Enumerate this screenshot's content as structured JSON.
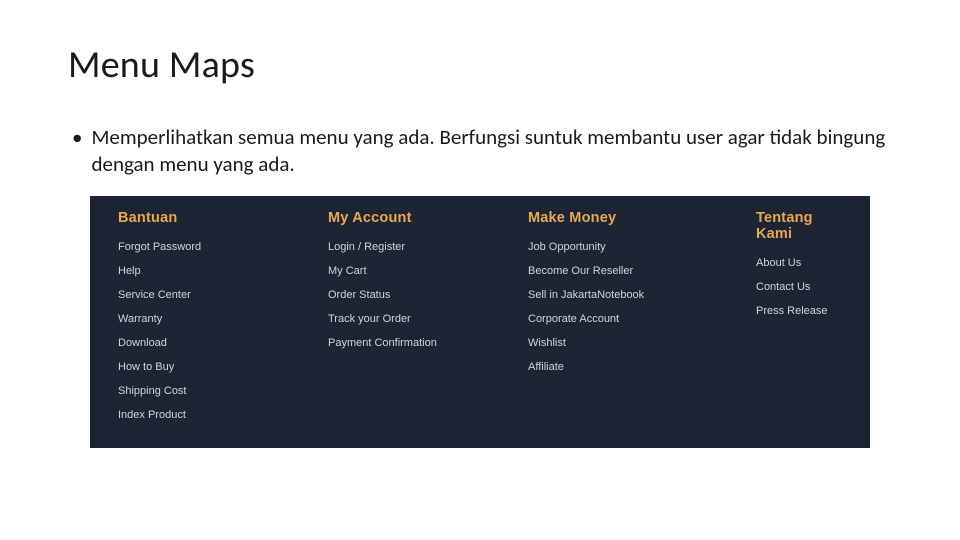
{
  "title": "Menu Maps",
  "bullet": "Memperlihatkan semua menu yang ada. Berfungsi suntuk membantu user agar tidak bingung dengan menu yang ada.",
  "footer": {
    "columns": [
      {
        "heading": "Bantuan",
        "links": [
          "Forgot Password",
          "Help",
          "Service Center",
          "Warranty",
          "Download",
          "How to Buy",
          "Shipping Cost",
          "Index Product"
        ]
      },
      {
        "heading": "My Account",
        "links": [
          "Login / Register",
          "My Cart",
          "Order Status",
          "Track your Order",
          "Payment Confirmation"
        ]
      },
      {
        "heading": "Make Money",
        "links": [
          "Job Opportunity",
          "Become Our Reseller",
          "Sell in JakartaNotebook",
          "Corporate Account",
          "Wishlist",
          "Affiliate"
        ]
      },
      {
        "heading": "Tentang Kami",
        "links": [
          "About Us",
          "Contact Us",
          "Press Release"
        ]
      }
    ]
  }
}
